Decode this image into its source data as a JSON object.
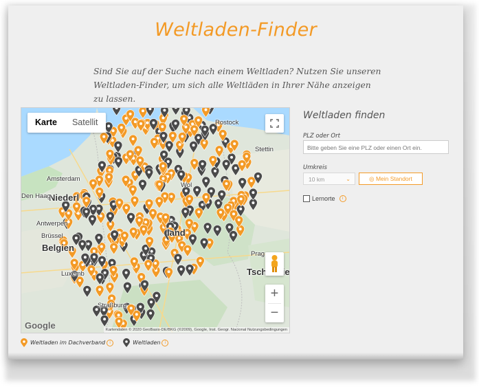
{
  "page": {
    "title": "Weltladen-Finder",
    "intro_line1": "Sind Sie auf der Suche nach einem Weltladen? Nutzen Sie unseren",
    "intro_line2": "Weltladen-Finder, um sich alle Weltläden in Ihrer Nähe anzeigen zu lassen."
  },
  "map": {
    "map_type_map": "Karte",
    "map_type_satellite": "Satellit",
    "zoom_in": "+",
    "zoom_out": "−",
    "logo": "Google",
    "attribution": "Kartendaten © 2020 GeoBasis-DE/BKG (©2009), Google, Inst. Geogr. Nacional   Nutzungsbedingungen",
    "cities": {
      "amsterdam": "Amsterdam",
      "den_haag": "Den Haag",
      "niederlande": "Niederl",
      "antwerpen": "Antwerpen",
      "bruessel": "Brüssel",
      "belgien": "Belgien",
      "luxemburg": "Luxemb",
      "strassburg": "Straßburg",
      "rostock": "Rostock",
      "stettin": "Stettin",
      "wolfsburg": "Wol",
      "prag": "Prag",
      "tschechien": "Tschechie",
      "deutschland": "land"
    },
    "colors": {
      "orange_pin": "#f39a26",
      "grey_pin": "#4a4a4a"
    }
  },
  "legend": {
    "dachverband": "Weltladen im Dachverband",
    "weltladen": "Weltladen"
  },
  "finder": {
    "heading": "Weltladen finden",
    "plz_label": "PLZ oder Ort",
    "plz_placeholder": "Bitte geben Sie eine PLZ oder einen Ort ein.",
    "umkreis_label": "Umkreis",
    "umkreis_value": "10 km",
    "standort_button": "Mein Standort",
    "lernorte_label": "Lernorte"
  }
}
